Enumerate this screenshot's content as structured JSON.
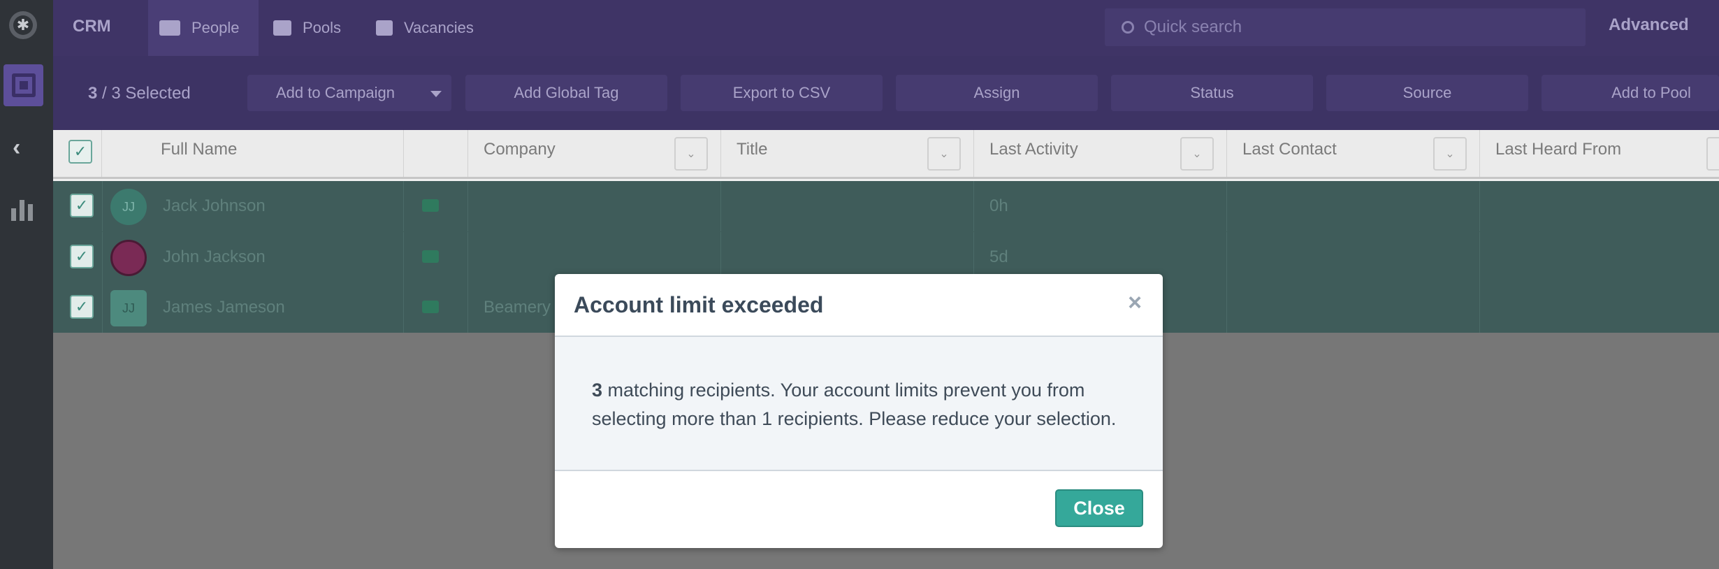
{
  "topbar": {
    "brand": "CRM",
    "tabs": [
      {
        "label": "People",
        "icon": "people-icon"
      },
      {
        "label": "Pools",
        "icon": "folder-icon"
      },
      {
        "label": "Vacancies",
        "icon": "briefcase-icon"
      }
    ],
    "search_placeholder": "Quick search",
    "advanced_label": "Advanced"
  },
  "actionbar": {
    "selected_count": "3",
    "selected_total": "/ 3 Selected",
    "buttons": [
      "Add to Campaign",
      "Add Global Tag",
      "Export to CSV",
      "Assign",
      "Status",
      "Source",
      "Add to Pool"
    ]
  },
  "table": {
    "columns": [
      "Full Name",
      "Company",
      "Title",
      "Last Activity",
      "Last Contact",
      "Last Heard From"
    ],
    "rows": [
      {
        "initials": "JJ",
        "name": "Jack Johnson",
        "company": "",
        "title": "",
        "last_activity": "0h"
      },
      {
        "initials": "",
        "name": "John Jackson",
        "company": "",
        "title": "",
        "last_activity": "5d"
      },
      {
        "initials": "JJ",
        "name": "James Jameson",
        "company": "Beamery",
        "title": "",
        "last_activity": ""
      }
    ]
  },
  "modal": {
    "title": "Account limit exceeded",
    "close_icon": "×",
    "count": "3",
    "message": " matching recipients. Your account limits prevent you from selecting more than 1 recipients. Please reduce your selection.",
    "close_label": "Close"
  },
  "colors": {
    "topbar": "#3f3466",
    "rows_overlay": "#3f5c5a",
    "close_button": "#35a89a"
  }
}
